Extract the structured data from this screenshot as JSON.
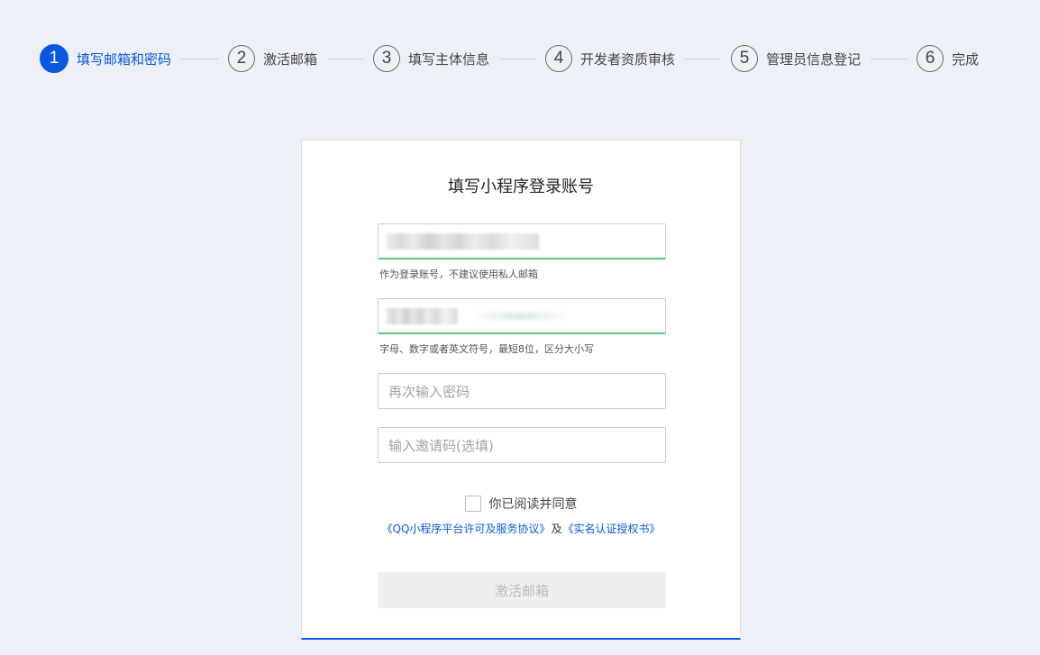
{
  "steps": [
    {
      "number": "1",
      "label": "填写邮箱和密码",
      "active": true
    },
    {
      "number": "2",
      "label": "激活邮箱",
      "active": false
    },
    {
      "number": "3",
      "label": "填写主体信息",
      "active": false
    },
    {
      "number": "4",
      "label": "开发者资质审核",
      "active": false
    },
    {
      "number": "5",
      "label": "管理员信息登记",
      "active": false
    },
    {
      "number": "6",
      "label": "完成",
      "active": false
    }
  ],
  "form": {
    "title": "填写小程序登录账号",
    "email_hint": "作为登录账号，不建议使用私人邮箱",
    "password_hint": "字母、数字或者英文符号，最短8位，区分大小写",
    "confirm_password_placeholder": "再次输入密码",
    "invite_code_placeholder": "输入邀请码(选填)",
    "agree_label": "你已阅读并同意",
    "agreement_link_1": "《QQ小程序平台许可及服务协议》",
    "agreement_joiner": "及",
    "agreement_link_2": "《实名认证授权书》",
    "submit_label": "激活邮箱"
  },
  "colors": {
    "accent": "#0a58e0",
    "valid_border": "#5ec67a",
    "page_background": "#edf0f6"
  }
}
